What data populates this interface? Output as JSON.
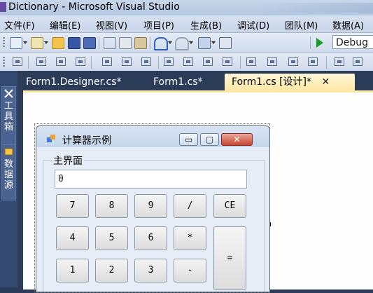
{
  "window": {
    "title": "Dictionary - Microsoft Visual Studio"
  },
  "menu": {
    "items": [
      "文件(F)",
      "编辑(E)",
      "视图(V)",
      "项目(P)",
      "生成(B)",
      "调试(D)",
      "团队(M)",
      "数据(A)"
    ]
  },
  "toolbar": {
    "icons": [
      "new-project-icon",
      "add-item-icon",
      "open-icon",
      "save-icon",
      "save-all-icon",
      "cut-icon",
      "copy-icon",
      "paste-icon",
      "undo-icon",
      "redo-icon",
      "navigate-icon",
      "find-icon",
      "start-icon"
    ],
    "config": "Debug"
  },
  "layout_toolbar": {
    "icons": [
      "align-grid-icon",
      "align-lefts-icon",
      "align-centers-icon",
      "align-rights-icon",
      "align-tops-icon",
      "align-middles-icon",
      "align-bottoms-icon",
      "make-same-width-icon",
      "make-same-height-icon",
      "make-same-size-icon",
      "size-to-grid-icon",
      "horizontal-spacing-icon",
      "increase-hspacing-icon",
      "decrease-hspacing-icon",
      "remove-hspacing-icon",
      "vertical-spacing-icon",
      "increase-vspacing-icon"
    ]
  },
  "side": {
    "toolbox": "工具箱",
    "datasource": "数据源"
  },
  "tabs": [
    {
      "label": "Form1.Designer.cs*",
      "active": false
    },
    {
      "label": "Form1.cs*",
      "active": false
    },
    {
      "label": "Form1.cs [设计]*",
      "active": true
    }
  ],
  "close_glyph": "✕",
  "form": {
    "title": "计算器示例",
    "minimize": "▭",
    "maximize": "▢",
    "close": "✕",
    "group_label": "主界面",
    "display_value": "0",
    "buttons": {
      "b7": "7",
      "b8": "8",
      "b9": "9",
      "div": "/",
      "ce": "CE",
      "b4": "4",
      "b5": "5",
      "b6": "6",
      "mul": "*",
      "b1": "1",
      "b2": "2",
      "b3": "3",
      "sub": "-",
      "eq": "="
    }
  },
  "colors": {
    "ide_background": "#2b3c59",
    "active_tab": "#ffe8a6",
    "close_button": "#c8442f",
    "start_green": "#1a9a2a"
  }
}
